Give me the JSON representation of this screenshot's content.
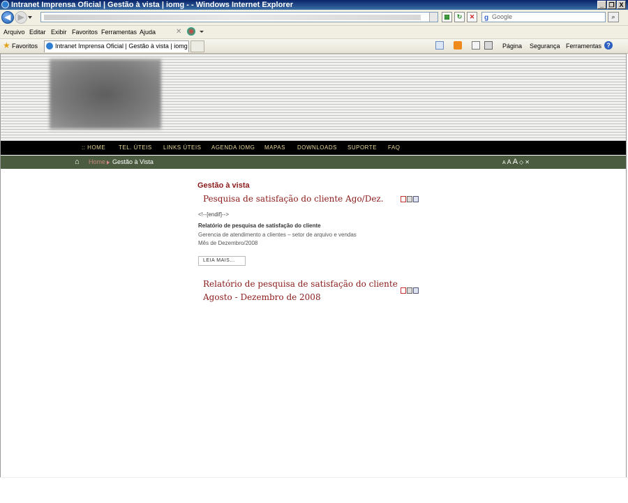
{
  "window": {
    "title": "Intranet Imprensa Oficial | Gestão à vista | iomg - - Windows Internet Explorer",
    "controls": [
      "_",
      "❐",
      "X"
    ]
  },
  "toolbar": {
    "search_placeholder": "Google"
  },
  "menu": {
    "items": [
      "Arquivo",
      "Editar",
      "Exibir",
      "Favoritos",
      "Ferramentas",
      "Ajuda"
    ]
  },
  "favbar": {
    "favorites_label": "Favoritos",
    "tab_title": "Intranet Imprensa Oficial | Gestão à vista | iomg -",
    "commands": {
      "page": "Página",
      "security": "Segurança",
      "tools": "Ferramentas"
    }
  },
  "site": {
    "nav": [
      ":: HOME",
      "TEL. ÚTEIS",
      "LINKS ÚTEIS",
      "AGENDA IOMG",
      "MAPAS",
      "DOWNLOADS",
      "SUPORTE",
      "FAQ"
    ],
    "breadcrumb": {
      "home": "Home",
      "current": "Gestão à Vista"
    },
    "font_controls": [
      "A",
      "A",
      "A",
      "◇",
      "✕"
    ]
  },
  "main": {
    "section_title": "Gestão à vista",
    "article1": {
      "title": "Pesquisa de satisfação do cliente Ago/Dez.",
      "endif": "<!--[endif]-->",
      "bold_line": "Relatório de pesquisa de satisfação do cliente",
      "line1": "Gerencia de atendimento a clientes – setor de arquivo e vendas",
      "line2": "Mês de Dezembro/2008",
      "read_more": "LEIA MAIS..."
    },
    "article2": {
      "title_line1": "Relatório de pesquisa de satisfação do cliente",
      "title_line2": "Agosto - Dezembro de 2008"
    }
  }
}
